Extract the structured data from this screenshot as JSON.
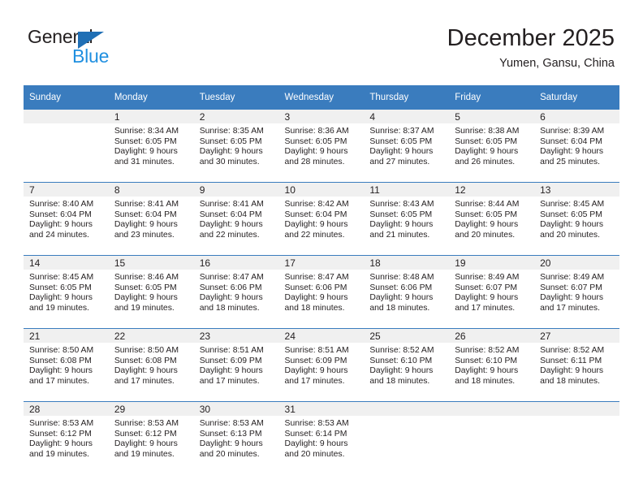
{
  "brand": {
    "name_part1": "General",
    "name_part2": "Blue",
    "logo_icon": "triangle-logo-icon"
  },
  "header": {
    "month_title": "December 2025",
    "location": "Yumen, Gansu, China"
  },
  "calendar": {
    "weekday_headers": [
      "Sunday",
      "Monday",
      "Tuesday",
      "Wednesday",
      "Thursday",
      "Friday",
      "Saturday"
    ],
    "accent_color": "#3a7cbe",
    "daynum_bg": "#f0f0f0",
    "weeks": [
      [
        {
          "day": "",
          "sunrise": "",
          "sunset": "",
          "daylight_line1": "",
          "daylight_line2": ""
        },
        {
          "day": "1",
          "sunrise": "Sunrise: 8:34 AM",
          "sunset": "Sunset: 6:05 PM",
          "daylight_line1": "Daylight: 9 hours",
          "daylight_line2": "and 31 minutes."
        },
        {
          "day": "2",
          "sunrise": "Sunrise: 8:35 AM",
          "sunset": "Sunset: 6:05 PM",
          "daylight_line1": "Daylight: 9 hours",
          "daylight_line2": "and 30 minutes."
        },
        {
          "day": "3",
          "sunrise": "Sunrise: 8:36 AM",
          "sunset": "Sunset: 6:05 PM",
          "daylight_line1": "Daylight: 9 hours",
          "daylight_line2": "and 28 minutes."
        },
        {
          "day": "4",
          "sunrise": "Sunrise: 8:37 AM",
          "sunset": "Sunset: 6:05 PM",
          "daylight_line1": "Daylight: 9 hours",
          "daylight_line2": "and 27 minutes."
        },
        {
          "day": "5",
          "sunrise": "Sunrise: 8:38 AM",
          "sunset": "Sunset: 6:05 PM",
          "daylight_line1": "Daylight: 9 hours",
          "daylight_line2": "and 26 minutes."
        },
        {
          "day": "6",
          "sunrise": "Sunrise: 8:39 AM",
          "sunset": "Sunset: 6:04 PM",
          "daylight_line1": "Daylight: 9 hours",
          "daylight_line2": "and 25 minutes."
        }
      ],
      [
        {
          "day": "7",
          "sunrise": "Sunrise: 8:40 AM",
          "sunset": "Sunset: 6:04 PM",
          "daylight_line1": "Daylight: 9 hours",
          "daylight_line2": "and 24 minutes."
        },
        {
          "day": "8",
          "sunrise": "Sunrise: 8:41 AM",
          "sunset": "Sunset: 6:04 PM",
          "daylight_line1": "Daylight: 9 hours",
          "daylight_line2": "and 23 minutes."
        },
        {
          "day": "9",
          "sunrise": "Sunrise: 8:41 AM",
          "sunset": "Sunset: 6:04 PM",
          "daylight_line1": "Daylight: 9 hours",
          "daylight_line2": "and 22 minutes."
        },
        {
          "day": "10",
          "sunrise": "Sunrise: 8:42 AM",
          "sunset": "Sunset: 6:04 PM",
          "daylight_line1": "Daylight: 9 hours",
          "daylight_line2": "and 22 minutes."
        },
        {
          "day": "11",
          "sunrise": "Sunrise: 8:43 AM",
          "sunset": "Sunset: 6:05 PM",
          "daylight_line1": "Daylight: 9 hours",
          "daylight_line2": "and 21 minutes."
        },
        {
          "day": "12",
          "sunrise": "Sunrise: 8:44 AM",
          "sunset": "Sunset: 6:05 PM",
          "daylight_line1": "Daylight: 9 hours",
          "daylight_line2": "and 20 minutes."
        },
        {
          "day": "13",
          "sunrise": "Sunrise: 8:45 AM",
          "sunset": "Sunset: 6:05 PM",
          "daylight_line1": "Daylight: 9 hours",
          "daylight_line2": "and 20 minutes."
        }
      ],
      [
        {
          "day": "14",
          "sunrise": "Sunrise: 8:45 AM",
          "sunset": "Sunset: 6:05 PM",
          "daylight_line1": "Daylight: 9 hours",
          "daylight_line2": "and 19 minutes."
        },
        {
          "day": "15",
          "sunrise": "Sunrise: 8:46 AM",
          "sunset": "Sunset: 6:05 PM",
          "daylight_line1": "Daylight: 9 hours",
          "daylight_line2": "and 19 minutes."
        },
        {
          "day": "16",
          "sunrise": "Sunrise: 8:47 AM",
          "sunset": "Sunset: 6:06 PM",
          "daylight_line1": "Daylight: 9 hours",
          "daylight_line2": "and 18 minutes."
        },
        {
          "day": "17",
          "sunrise": "Sunrise: 8:47 AM",
          "sunset": "Sunset: 6:06 PM",
          "daylight_line1": "Daylight: 9 hours",
          "daylight_line2": "and 18 minutes."
        },
        {
          "day": "18",
          "sunrise": "Sunrise: 8:48 AM",
          "sunset": "Sunset: 6:06 PM",
          "daylight_line1": "Daylight: 9 hours",
          "daylight_line2": "and 18 minutes."
        },
        {
          "day": "19",
          "sunrise": "Sunrise: 8:49 AM",
          "sunset": "Sunset: 6:07 PM",
          "daylight_line1": "Daylight: 9 hours",
          "daylight_line2": "and 17 minutes."
        },
        {
          "day": "20",
          "sunrise": "Sunrise: 8:49 AM",
          "sunset": "Sunset: 6:07 PM",
          "daylight_line1": "Daylight: 9 hours",
          "daylight_line2": "and 17 minutes."
        }
      ],
      [
        {
          "day": "21",
          "sunrise": "Sunrise: 8:50 AM",
          "sunset": "Sunset: 6:08 PM",
          "daylight_line1": "Daylight: 9 hours",
          "daylight_line2": "and 17 minutes."
        },
        {
          "day": "22",
          "sunrise": "Sunrise: 8:50 AM",
          "sunset": "Sunset: 6:08 PM",
          "daylight_line1": "Daylight: 9 hours",
          "daylight_line2": "and 17 minutes."
        },
        {
          "day": "23",
          "sunrise": "Sunrise: 8:51 AM",
          "sunset": "Sunset: 6:09 PM",
          "daylight_line1": "Daylight: 9 hours",
          "daylight_line2": "and 17 minutes."
        },
        {
          "day": "24",
          "sunrise": "Sunrise: 8:51 AM",
          "sunset": "Sunset: 6:09 PM",
          "daylight_line1": "Daylight: 9 hours",
          "daylight_line2": "and 17 minutes."
        },
        {
          "day": "25",
          "sunrise": "Sunrise: 8:52 AM",
          "sunset": "Sunset: 6:10 PM",
          "daylight_line1": "Daylight: 9 hours",
          "daylight_line2": "and 18 minutes."
        },
        {
          "day": "26",
          "sunrise": "Sunrise: 8:52 AM",
          "sunset": "Sunset: 6:10 PM",
          "daylight_line1": "Daylight: 9 hours",
          "daylight_line2": "and 18 minutes."
        },
        {
          "day": "27",
          "sunrise": "Sunrise: 8:52 AM",
          "sunset": "Sunset: 6:11 PM",
          "daylight_line1": "Daylight: 9 hours",
          "daylight_line2": "and 18 minutes."
        }
      ],
      [
        {
          "day": "28",
          "sunrise": "Sunrise: 8:53 AM",
          "sunset": "Sunset: 6:12 PM",
          "daylight_line1": "Daylight: 9 hours",
          "daylight_line2": "and 19 minutes."
        },
        {
          "day": "29",
          "sunrise": "Sunrise: 8:53 AM",
          "sunset": "Sunset: 6:12 PM",
          "daylight_line1": "Daylight: 9 hours",
          "daylight_line2": "and 19 minutes."
        },
        {
          "day": "30",
          "sunrise": "Sunrise: 8:53 AM",
          "sunset": "Sunset: 6:13 PM",
          "daylight_line1": "Daylight: 9 hours",
          "daylight_line2": "and 20 minutes."
        },
        {
          "day": "31",
          "sunrise": "Sunrise: 8:53 AM",
          "sunset": "Sunset: 6:14 PM",
          "daylight_line1": "Daylight: 9 hours",
          "daylight_line2": "and 20 minutes."
        },
        {
          "day": "",
          "sunrise": "",
          "sunset": "",
          "daylight_line1": "",
          "daylight_line2": ""
        },
        {
          "day": "",
          "sunrise": "",
          "sunset": "",
          "daylight_line1": "",
          "daylight_line2": ""
        },
        {
          "day": "",
          "sunrise": "",
          "sunset": "",
          "daylight_line1": "",
          "daylight_line2": ""
        }
      ]
    ]
  }
}
